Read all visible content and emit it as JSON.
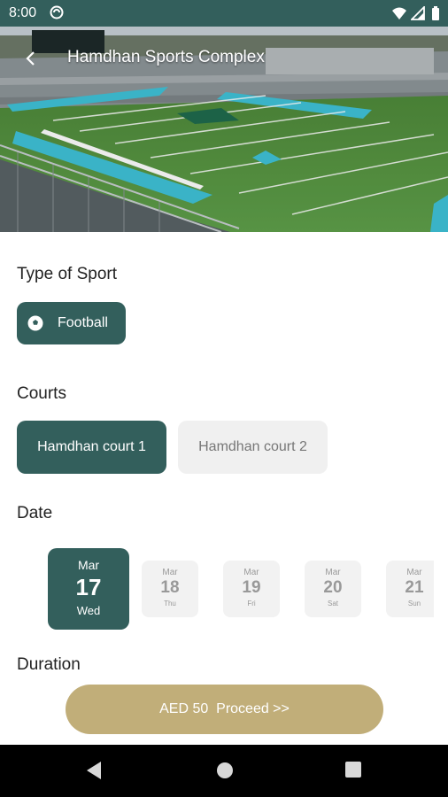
{
  "status_bar": {
    "time": "8:00"
  },
  "header": {
    "title": "Hamdhan Sports Complex"
  },
  "sport_section": {
    "title": "Type of Sport",
    "selected_sport": "Football"
  },
  "courts_section": {
    "title": "Courts",
    "courts": [
      {
        "label": "Hamdhan court 1",
        "selected": true
      },
      {
        "label": "Hamdhan court 2",
        "selected": false
      }
    ]
  },
  "date_section": {
    "title": "Date",
    "dates": [
      {
        "month": "Mar",
        "day": "17",
        "weekday": "Wed",
        "selected": true
      },
      {
        "month": "Mar",
        "day": "18",
        "weekday": "Thu",
        "selected": false
      },
      {
        "month": "Mar",
        "day": "19",
        "weekday": "Fri",
        "selected": false
      },
      {
        "month": "Mar",
        "day": "20",
        "weekday": "Sat",
        "selected": false
      },
      {
        "month": "Mar",
        "day": "21",
        "weekday": "Sun",
        "selected": false
      }
    ]
  },
  "duration_section": {
    "title": "Duration"
  },
  "proceed_button": {
    "label": "AED 50  Proceed >>"
  },
  "colors": {
    "primary": "#335f5c",
    "accent": "#c1ae79",
    "chip_inactive": "#f0f0f0"
  },
  "icons": [
    "sync-icon",
    "wifi-icon",
    "signal-icon",
    "battery-icon",
    "back-arrow-icon",
    "football-icon",
    "nav-back-icon",
    "nav-home-icon",
    "nav-recents-icon"
  ]
}
